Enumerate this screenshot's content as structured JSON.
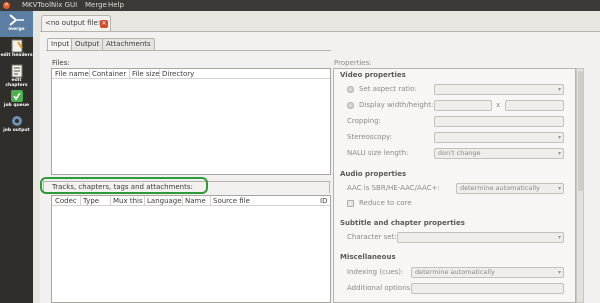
{
  "menubar": {
    "app_title": "MKVToolNix GUI",
    "menu_merge": "Merge",
    "menu_help": "Help"
  },
  "sidebar": {
    "items": [
      {
        "label": "merge"
      },
      {
        "label": "edit headers"
      },
      {
        "label": "edit chapters"
      },
      {
        "label": "job queue"
      },
      {
        "label": "job output"
      }
    ]
  },
  "file_tab": {
    "label": "<no output file>",
    "close": "✕"
  },
  "subtabs": {
    "input": "Input",
    "output": "Output",
    "attachments": "Attachments"
  },
  "files": {
    "label": "Files:",
    "columns": [
      "File name",
      "Container",
      "File size",
      "Directory"
    ]
  },
  "tracks": {
    "label": "Tracks, chapters, tags and attachments:",
    "columns": [
      "Codec",
      "Type",
      "Mux this",
      "Language",
      "Name",
      "Source file",
      "ID"
    ]
  },
  "properties": {
    "label": "Properties:",
    "video": {
      "title": "Video properties",
      "set_aspect_ratio": "Set aspect ratio:",
      "display_wh": "Display width/height:",
      "x": "x",
      "cropping": "Cropping:",
      "stereoscopy": "Stereoscopy:",
      "nalu": "NALU size length:",
      "nalu_value": "don't change"
    },
    "audio": {
      "title": "Audio properties",
      "sbr": "AAC is SBR/HE-AAC/AAC+:",
      "sbr_value": "determine automatically",
      "reduce_to_core": "Reduce to core"
    },
    "subtitle": {
      "title": "Subtitle and chapter properties",
      "charset": "Character set:"
    },
    "misc": {
      "title": "Miscellaneous",
      "indexing": "Indexing (cues):",
      "indexing_value": "determine automatically",
      "additional": "Additional options:"
    }
  },
  "colors": {
    "highlight": "#2f9a3a",
    "sidebar_bg": "#2f2e2b",
    "sidebar_active": "#5c7ea2",
    "close_button": "#d14a2a"
  }
}
